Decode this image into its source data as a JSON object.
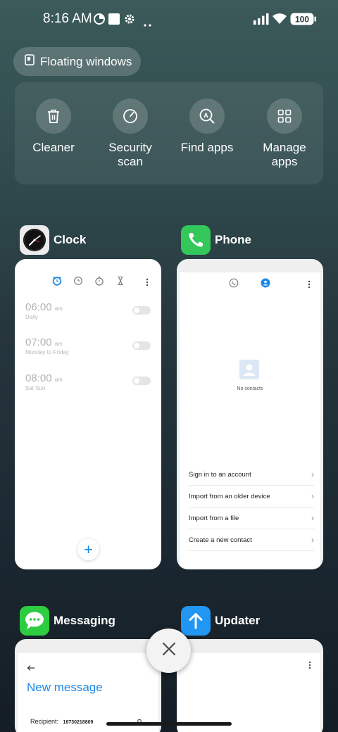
{
  "status_bar": {
    "time": "8:16 AM",
    "icons": [
      "data-saver-icon",
      "square-icon",
      "gear-icon",
      "more-dots-icon",
      "signal-icon",
      "wifi-icon"
    ],
    "battery": "100"
  },
  "floating_windows": {
    "label": "Floating windows",
    "icon": "floating-window-icon"
  },
  "quick_actions": [
    {
      "label": "Cleaner",
      "icon": "trash-icon"
    },
    {
      "label": "Security scan",
      "icon": "gauge-icon"
    },
    {
      "label": "Find apps",
      "icon": "search-app-icon"
    },
    {
      "label": "Manage apps",
      "icon": "grid-icon"
    }
  ],
  "recent_apps": {
    "clock": {
      "name": "Clock",
      "alarms": [
        {
          "time": "06:00",
          "ampm": "am",
          "days": "Daily"
        },
        {
          "time": "07:00",
          "ampm": "am",
          "days": "Monday to Friday"
        },
        {
          "time": "08:00",
          "ampm": "am",
          "days": "Sat Sun"
        }
      ],
      "fab": "+"
    },
    "phone": {
      "name": "Phone",
      "empty_text": "No contacts",
      "options": [
        "Sign in to an account",
        "Import from an older device",
        "Import from a file",
        "Create a new contact"
      ]
    },
    "messaging": {
      "name": "Messaging",
      "title": "New message",
      "recipient_label": "Recipient:",
      "recipient_value": "18730218809"
    },
    "updater": {
      "name": "Updater"
    }
  },
  "colors": {
    "accent_blue": "#1e88e5",
    "phone_green": "#34c759",
    "messaging_green": "#2ecc40",
    "updater_blue": "#2196f3"
  }
}
